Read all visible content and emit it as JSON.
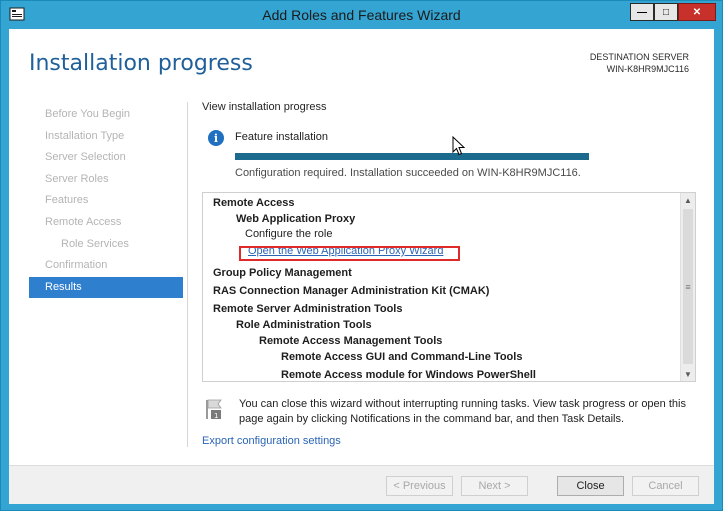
{
  "window": {
    "title": "Add Roles and Features Wizard",
    "minimize_symbol": "—",
    "maximize_symbol": "□",
    "close_symbol": "✕"
  },
  "header": {
    "page_title": "Installation progress",
    "destination_label": "DESTINATION SERVER",
    "destination_server": "WIN-K8HR9MJC116"
  },
  "nav": {
    "items": [
      {
        "label": "Before You Begin",
        "state": "disabled"
      },
      {
        "label": "Installation Type",
        "state": "disabled"
      },
      {
        "label": "Server Selection",
        "state": "disabled"
      },
      {
        "label": "Server Roles",
        "state": "disabled"
      },
      {
        "label": "Features",
        "state": "disabled"
      },
      {
        "label": "Remote Access",
        "state": "disabled"
      },
      {
        "label": "Role Services",
        "state": "disabled"
      },
      {
        "label": "Confirmation",
        "state": "disabled"
      },
      {
        "label": "Results",
        "state": "active"
      }
    ]
  },
  "main": {
    "view_progress": "View installation progress",
    "feature_label": "Feature installation",
    "progress_percent": 100,
    "status_text": "Configuration required. Installation succeeded on WIN-K8HR9MJC116.",
    "results": [
      {
        "text": "Remote Access",
        "style": "bold",
        "level": 0
      },
      {
        "text": "Web Application Proxy",
        "style": "bold",
        "level": 1
      },
      {
        "text": "Configure the role",
        "style": "normal",
        "level": 2
      },
      {
        "text": "Open the Web Application Proxy Wizard",
        "style": "link",
        "level": 2
      },
      {
        "text": "Group Policy Management",
        "style": "bold",
        "level": 0
      },
      {
        "text": "RAS Connection Manager Administration Kit (CMAK)",
        "style": "bold",
        "level": 0
      },
      {
        "text": "Remote Server Administration Tools",
        "style": "bold",
        "level": 0
      },
      {
        "text": "Role Administration Tools",
        "style": "bold",
        "level": 1
      },
      {
        "text": "Remote Access Management Tools",
        "style": "bold",
        "level": 2
      },
      {
        "text": "Remote Access GUI and Command-Line Tools",
        "style": "bold",
        "level": 3
      },
      {
        "text": "Remote Access module for Windows PowerShell",
        "style": "bold",
        "level": 3
      }
    ],
    "notice": "You can close this wizard without interrupting running tasks. View task progress or open this page again by clicking Notifications in the command bar, and then Task Details.",
    "export_link": "Export configuration settings"
  },
  "footer": {
    "previous_label": "< Previous",
    "next_label": "Next >",
    "close_label": "Close",
    "cancel_label": "Cancel"
  },
  "colors": {
    "titlebar": "#34a4d3",
    "accent": "#2f7fcf",
    "progress_fill": "#1c6a8e",
    "link": "#2a64b5",
    "highlight": "#e02a2a"
  }
}
